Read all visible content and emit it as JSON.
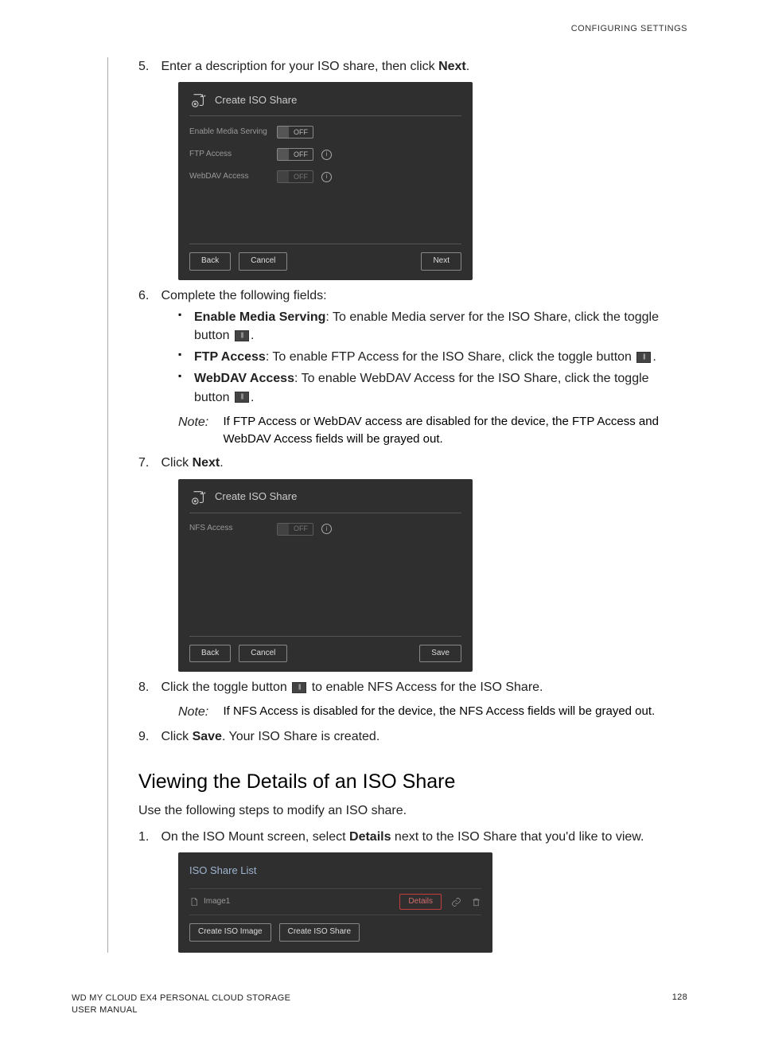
{
  "header": {
    "section": "CONFIGURING SETTINGS"
  },
  "steps": {
    "s5": {
      "pre": "Enter a description for your ISO share, then click ",
      "bold": "Next",
      "post": "."
    },
    "s6": {
      "intro": "Complete the following fields:",
      "b1": {
        "bold": "Enable Media Serving",
        "text": ": To enable Media server for the ISO Share, click the toggle button"
      },
      "b2": {
        "bold": "FTP Access",
        "text": ": To enable FTP Access for the ISO Share, click the toggle button"
      },
      "b3": {
        "bold": "WebDAV Access",
        "text": ": To enable WebDAV Access for the ISO Share, click the toggle button"
      },
      "note_label": "Note:",
      "note_text": "If FTP Access or WebDAV access are disabled for the device, the FTP Access and WebDAV Access fields will be grayed out."
    },
    "s7": {
      "pre": "Click ",
      "bold": "Next",
      "post": "."
    },
    "s8": {
      "pre": "Click the toggle button",
      "post": "to enable NFS Access for the ISO Share.",
      "note_label": "Note:",
      "note_text": "If NFS Access is disabled for the device, the NFS Access fields will be grayed out."
    },
    "s9": {
      "pre": "Click ",
      "bold": "Save",
      "post": ". Your ISO Share is created."
    }
  },
  "dialog1": {
    "title": "Create ISO Share",
    "media_label": "Enable Media Serving",
    "ftp_label": "FTP Access",
    "webdav_label": "WebDAV Access",
    "off": "OFF",
    "back": "Back",
    "cancel": "Cancel",
    "next": "Next"
  },
  "dialog2": {
    "title": "Create ISO Share",
    "nfs_label": "NFS Access",
    "off": "OFF",
    "back": "Back",
    "cancel": "Cancel",
    "save": "Save"
  },
  "section2": {
    "heading": "Viewing the Details of an ISO Share",
    "intro": "Use the following steps to modify an ISO share.",
    "s1": {
      "pre": "On the ISO Mount screen, select ",
      "bold": "Details",
      "post": " next to the ISO Share that you'd like to view."
    }
  },
  "listpanel": {
    "title": "ISO Share List",
    "item": "Image1",
    "details": "Details",
    "btn1": "Create ISO Image",
    "btn2": "Create ISO Share"
  },
  "footer": {
    "line1": "WD MY CLOUD EX4 PERSONAL CLOUD STORAGE",
    "line2": "USER MANUAL",
    "page": "128"
  }
}
